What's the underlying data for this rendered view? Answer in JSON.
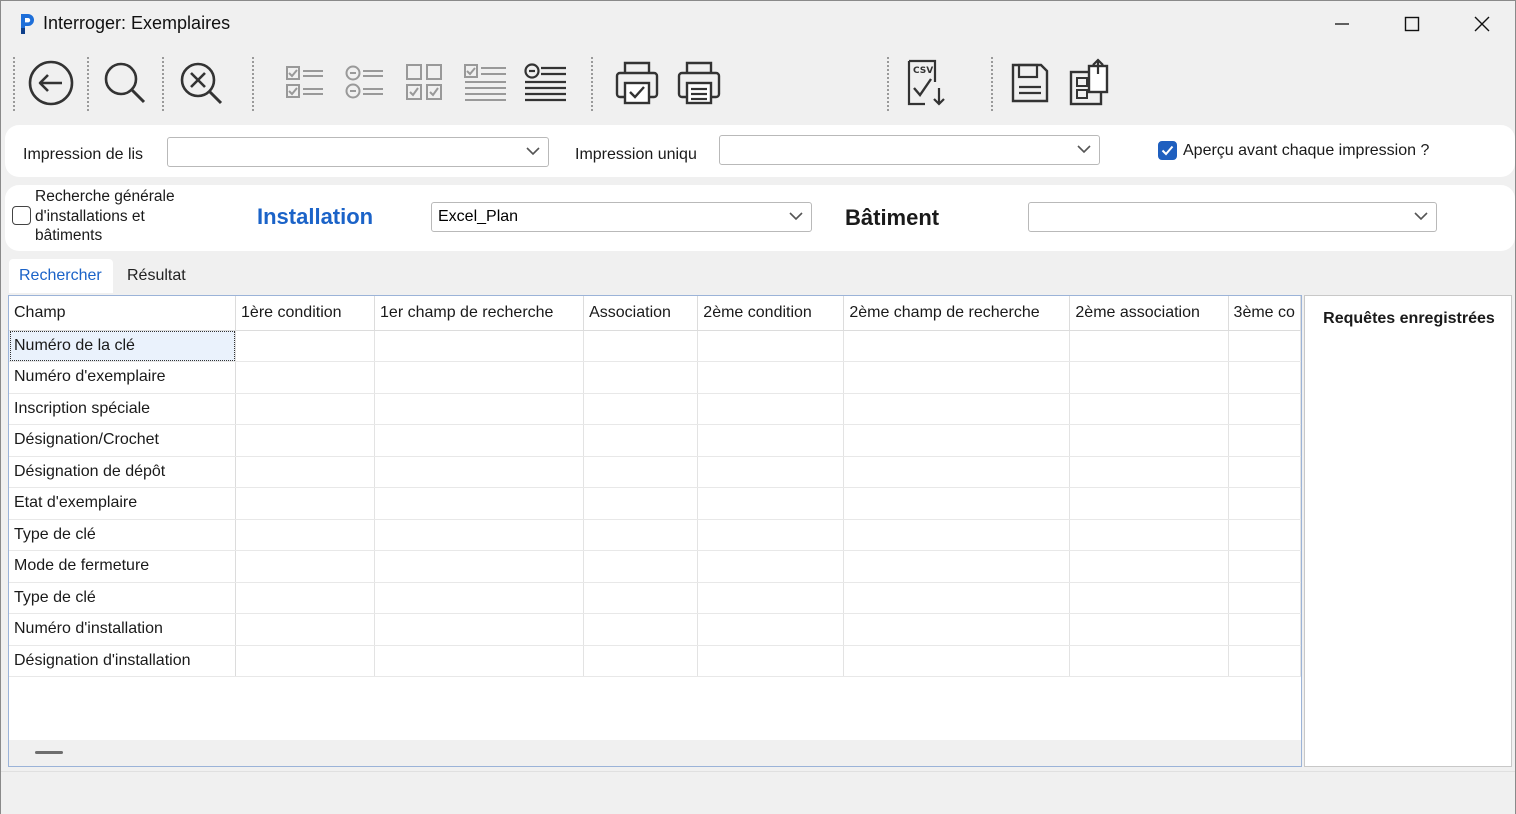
{
  "window": {
    "title": "Interroger: Exemplaires"
  },
  "toolbar": {
    "buttons": [
      {
        "name": "back",
        "icon": "back-arrow-icon"
      },
      {
        "name": "search",
        "icon": "magnifier-icon"
      },
      {
        "name": "clear-search",
        "icon": "zoom-cancel-icon"
      },
      {
        "name": "checklist",
        "icon": "checklist-icon"
      },
      {
        "name": "radio-list",
        "icon": "radio-list-icon"
      },
      {
        "name": "checkbox-grid",
        "icon": "checkbox-grid-icon"
      },
      {
        "name": "check-lines",
        "icon": "check-lines-icon"
      },
      {
        "name": "radio-lines",
        "icon": "radio-lines-icon"
      },
      {
        "name": "print-checked",
        "icon": "print-check-icon"
      },
      {
        "name": "print-list",
        "icon": "print-list-icon"
      },
      {
        "name": "csv-export",
        "icon": "csv-export-icon",
        "icon_text": "CSV"
      },
      {
        "name": "save",
        "icon": "floppy-disk-icon"
      },
      {
        "name": "transfer",
        "icon": "transfer-icon"
      }
    ]
  },
  "print": {
    "list_label": "Impression de lis",
    "list_value": "",
    "single_label": "Impression uniqu",
    "single_value": "",
    "preview_label": "Aperçu avant chaque impression ?",
    "preview_checked": true
  },
  "filter": {
    "general_search_label_line1": "Recherche générale",
    "general_search_label_line2": "d'installations et",
    "general_search_label_line3": "bâtiments",
    "general_search_checked": false,
    "installation_label": "Installation",
    "installation_value": "Excel_Plan",
    "building_label": "Bâtiment",
    "building_value": ""
  },
  "tabs": [
    {
      "label": "Rechercher",
      "active": true
    },
    {
      "label": "Résultat",
      "active": false
    }
  ],
  "grid": {
    "columns": [
      "Champ",
      "1ère condition",
      "1er champ de recherche",
      "Association",
      "2ème condition",
      "2ème champ de recherche",
      "2ème association",
      "3ème co"
    ],
    "rows": [
      "Numéro de la clé",
      "Numéro d'exemplaire",
      "Inscription spéciale",
      "Désignation/Crochet",
      "Désignation de dépôt",
      "Etat d'exemplaire",
      "Type de clé",
      "Mode de fermeture",
      "Type de clé",
      "Numéro d'installation",
      "Désignation d'installation"
    ],
    "selected_row": 0
  },
  "saved_queries": {
    "title": "Requêtes enregistrées"
  },
  "colors": {
    "accent": "#1b63c8",
    "checkbox": "#1f5fbf",
    "background": "#f0f0f0"
  }
}
